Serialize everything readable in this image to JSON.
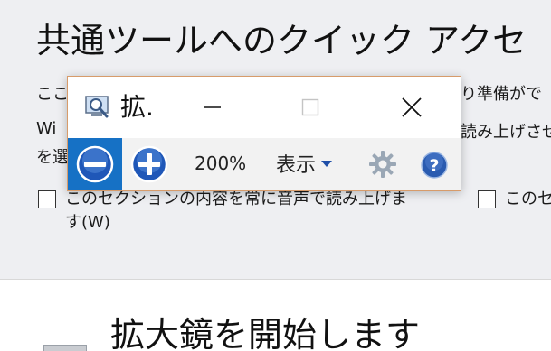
{
  "page": {
    "heading": "共通ツールへのクイック アクセ",
    "line1_left": "ここ",
    "line1_right": "り準備がで",
    "line2_left": "Wi",
    "line2_right": "読み上げさせ",
    "line3_left": "を選",
    "checkbox1_label": "このセクションの内容を常に音声で読み上げます(W)",
    "checkbox2_label": "このセ",
    "launch_label": "拡大鏡を開始します"
  },
  "magnifier": {
    "title": "拡.",
    "zoom_level": "200%",
    "view_label": "表示",
    "icons": {
      "app": "magnifier-app-icon",
      "minimize": "minimize-icon",
      "maximize": "maximize-icon",
      "close": "close-icon",
      "zoom_out": "zoom-out-icon",
      "zoom_in": "zoom-in-icon",
      "view_dropdown": "dropdown-arrow-icon",
      "settings": "gear-icon",
      "help": "help-icon"
    }
  },
  "colors": {
    "accent_blue": "#1671c5",
    "window_border": "#d79b6a",
    "panel_background": "#eeeff2"
  }
}
